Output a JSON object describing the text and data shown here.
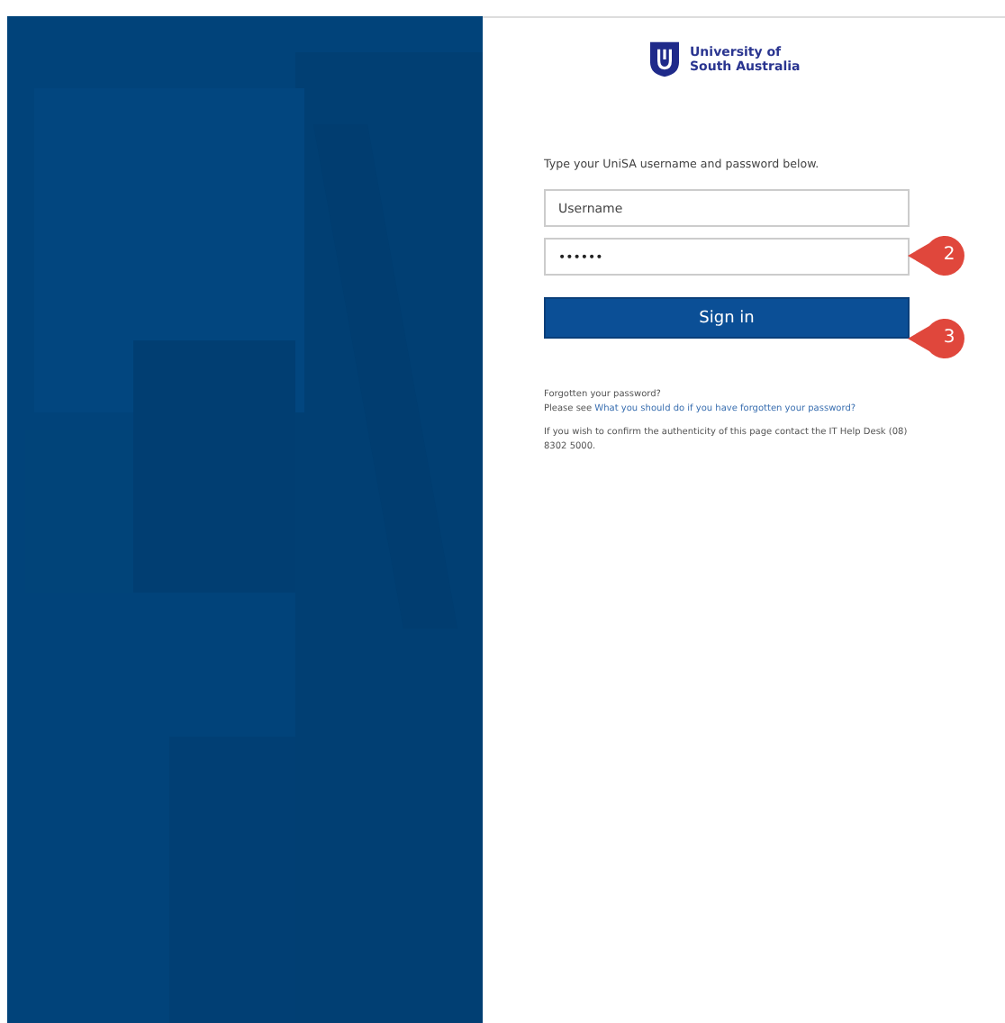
{
  "logo": {
    "line_1": "University of",
    "line_2": "South Australia"
  },
  "instructions": "Type your UniSA username and password below.",
  "username": {
    "placeholder": "Username"
  },
  "password": {
    "value": "••••••"
  },
  "sign_in_button": "Sign in",
  "callouts": [
    {
      "label": "2"
    },
    {
      "label": "3"
    }
  ],
  "forgotten": {
    "heading": "Forgotten your password?",
    "prefix": "Please see",
    "link": "What you should do if you have forgotten your password?"
  },
  "help_text": "If you wish to confirm the authenticity of this page contact the IT Help Desk (08) 8302 5000."
}
